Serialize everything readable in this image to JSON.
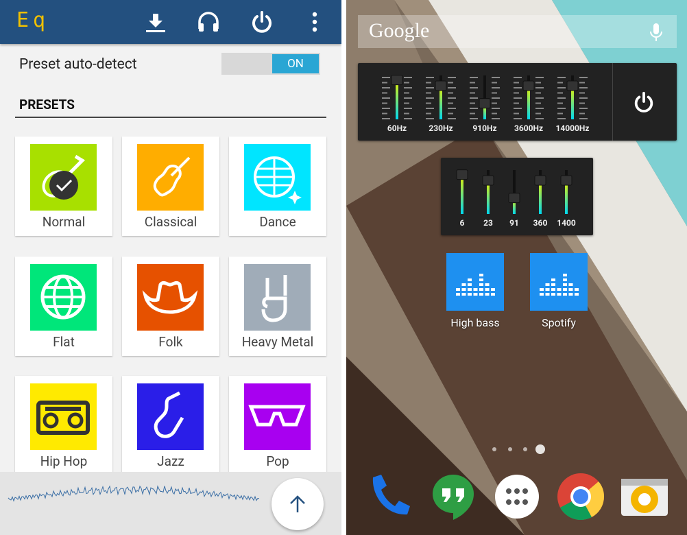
{
  "app": {
    "logo": "Eq",
    "toolbar_icons": [
      "download-icon",
      "headphones-icon",
      "power-icon",
      "more-vert-icon"
    ],
    "auto_detect_label": "Preset auto-detect",
    "auto_detect_toggle": "ON",
    "presets_heading": "PRESETS",
    "presets": [
      {
        "label": "Normal",
        "color": "#a8e000",
        "icon": "guitar-icon",
        "selected": true
      },
      {
        "label": "Classical",
        "color": "#ffad00",
        "icon": "violin-icon"
      },
      {
        "label": "Dance",
        "color": "#00e5ff",
        "icon": "disco-ball-icon"
      },
      {
        "label": "Flat",
        "color": "#00e67a",
        "icon": "globe-icon"
      },
      {
        "label": "Folk",
        "color": "#e65100",
        "icon": "cowboy-hat-icon"
      },
      {
        "label": "Heavy Metal",
        "color": "#a0acb8",
        "icon": "rock-hand-icon"
      },
      {
        "label": "Hip Hop",
        "color": "#ffea00",
        "icon": "boombox-icon"
      },
      {
        "label": "Jazz",
        "color": "#2a1ee8",
        "icon": "saxophone-icon"
      },
      {
        "label": "Pop",
        "color": "#a800f0",
        "icon": "sunglasses-icon"
      }
    ],
    "fab_icon": "arrow-up-icon"
  },
  "home": {
    "search_logo": "Google",
    "widget_large": {
      "bands": [
        {
          "label": "60Hz",
          "level": 0.88
        },
        {
          "label": "230Hz",
          "level": 0.75
        },
        {
          "label": "910Hz",
          "level": 0.35
        },
        {
          "label": "3600Hz",
          "level": 0.75
        },
        {
          "label": "14000Hz",
          "level": 0.75
        }
      ]
    },
    "widget_small": {
      "bands": [
        {
          "label": "6",
          "level": 0.88
        },
        {
          "label": "23",
          "level": 0.75
        },
        {
          "label": "91",
          "level": 0.35
        },
        {
          "label": "360",
          "level": 0.75
        },
        {
          "label": "1400",
          "level": 0.75
        }
      ]
    },
    "shortcuts": [
      {
        "label": "High bass"
      },
      {
        "label": "Spotify"
      }
    ],
    "page_indicator": {
      "pages": 4,
      "current": 4
    },
    "dock": [
      "phone-icon",
      "hangouts-icon",
      "app-drawer-icon",
      "chrome-icon",
      "camera-icon"
    ]
  }
}
